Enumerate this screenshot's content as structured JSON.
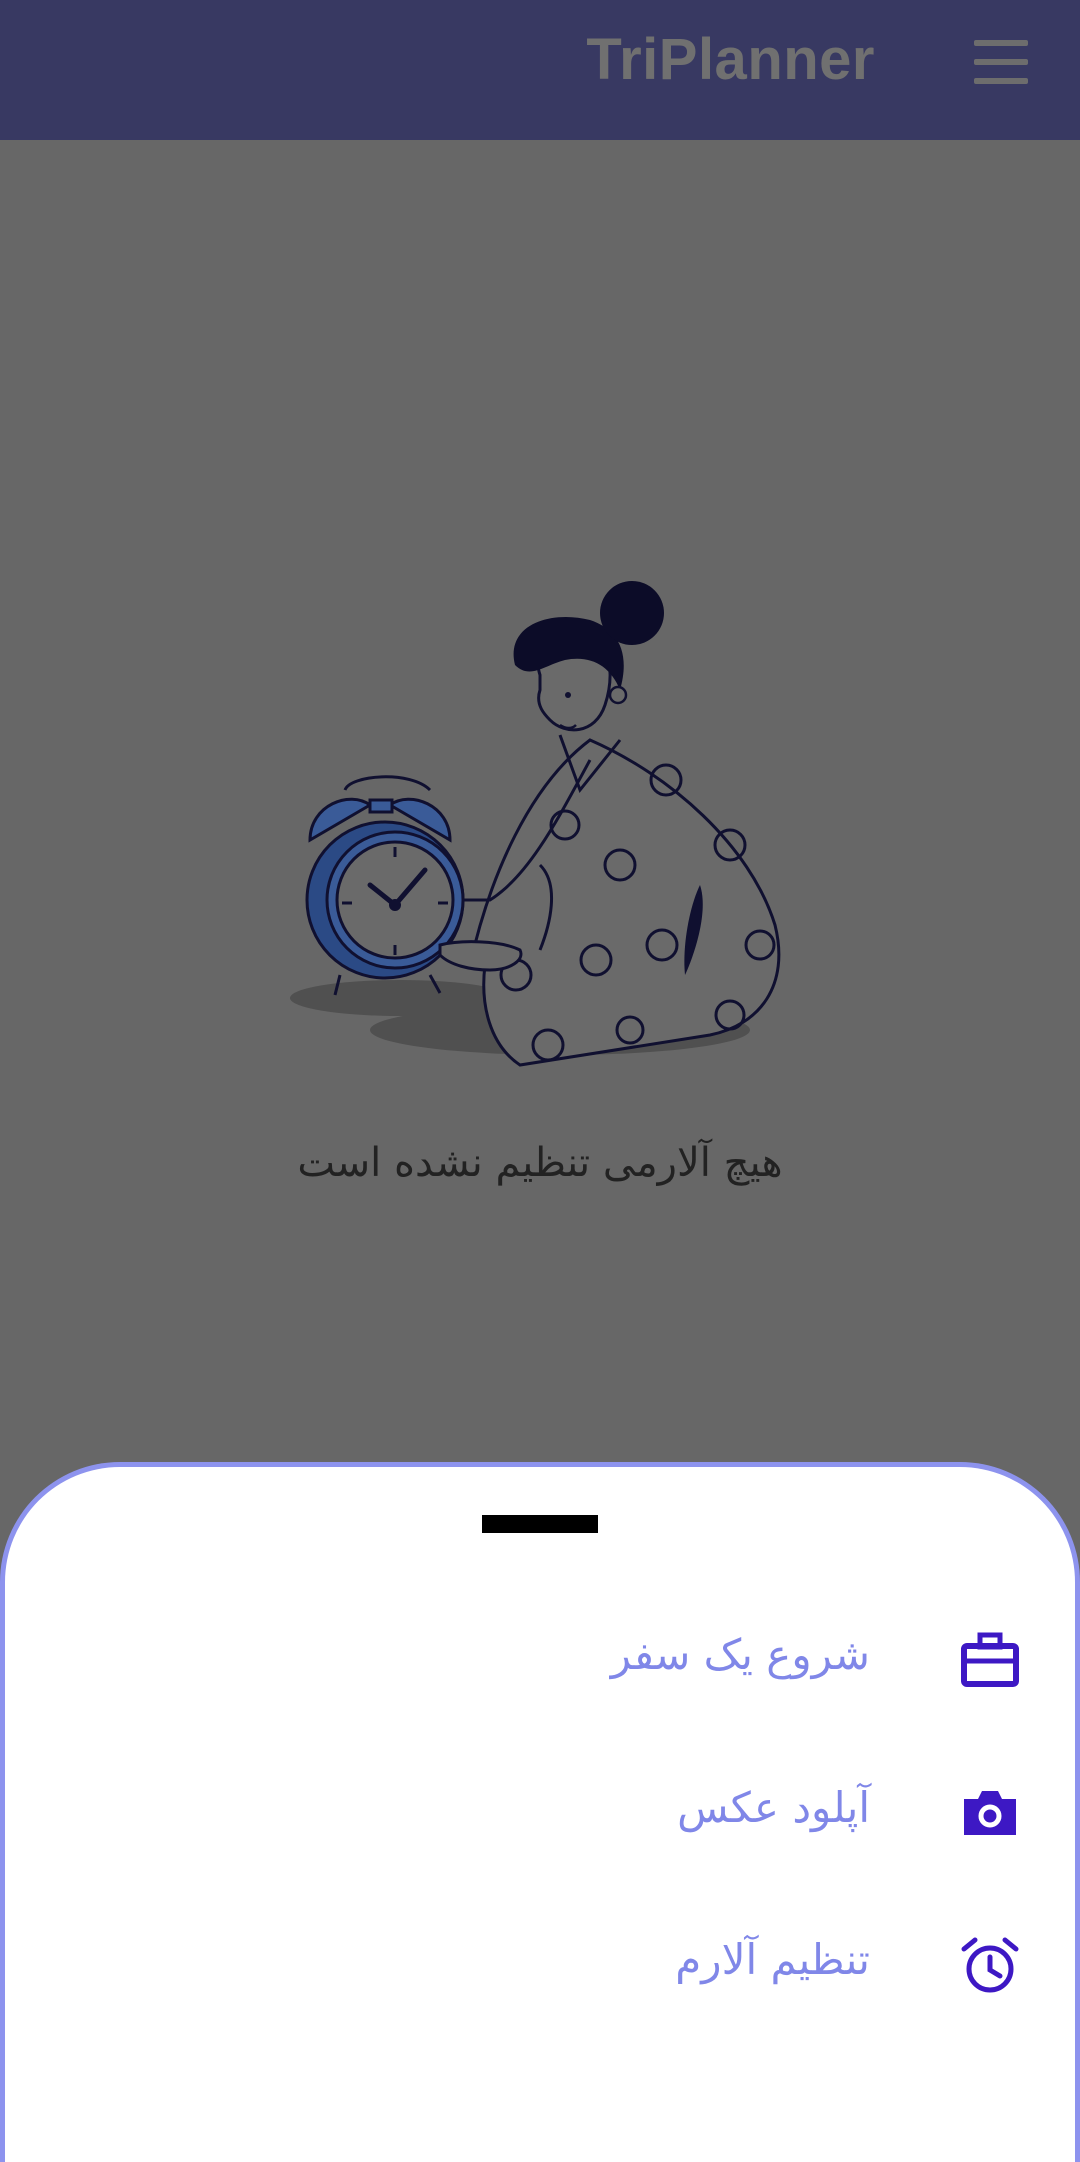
{
  "app": {
    "title": "TriPlanner",
    "icons": {
      "menu": "menu-icon"
    }
  },
  "main": {
    "empty_state_text": "هیچ آلارمی تنظیم نشده است"
  },
  "bottom_sheet": {
    "options": [
      {
        "label": "شروع یک سفر",
        "icon": "briefcase-icon"
      },
      {
        "label": "آپلود عکس",
        "icon": "camera-icon"
      },
      {
        "label": "تنظیم آلارم",
        "icon": "alarm-clock-icon"
      }
    ]
  },
  "colors": {
    "appbar": "#383962",
    "overlay": "#676767",
    "accent": "#3d18c4",
    "option_text": "#8087e8",
    "sheet_border": "#8d93ee"
  }
}
